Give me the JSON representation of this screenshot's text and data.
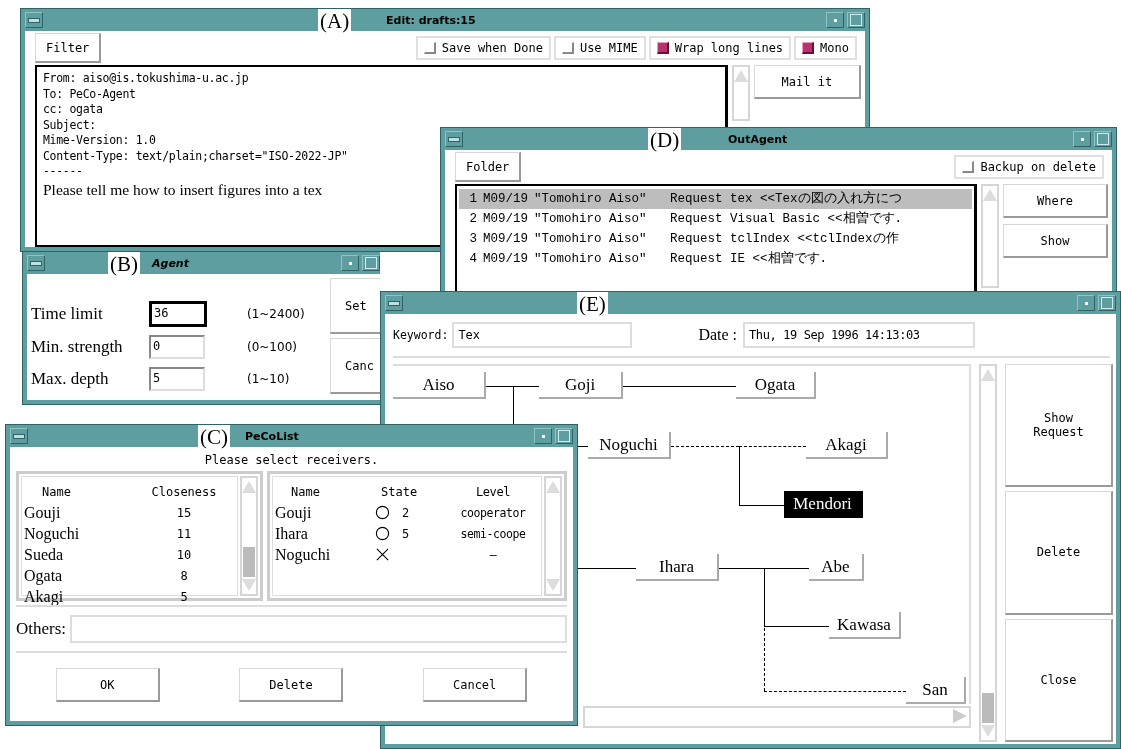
{
  "edit_window": {
    "annotation": "(A)",
    "title": "Edit: drafts:15",
    "filter_button": "Filter",
    "options": [
      {
        "label": "Save when Done",
        "checked": false
      },
      {
        "label": "Use MIME",
        "checked": false
      },
      {
        "label": "Wrap long lines",
        "checked": true
      },
      {
        "label": "Mono",
        "checked": true
      }
    ],
    "header_lines": [
      "From: aiso@is.tokushima-u.ac.jp",
      "To: PeCo-Agent",
      "cc: ogata",
      "Subject:",
      "Mime-Version: 1.0",
      "Content-Type: text/plain;charset=\"ISO-2022-JP\"",
      "------"
    ],
    "body_text": "Please tell me how to insert figures into a tex",
    "mail_button": "Mail it"
  },
  "outagent_window": {
    "annotation": "(D)",
    "title": "OutAgent",
    "folder_button": "Folder",
    "backup": {
      "label": "Backup on delete",
      "checked": false
    },
    "messages": [
      {
        "number": "1",
        "date": "M09/19",
        "sender": "\"Tomohiro Aiso\"",
        "subject": "Request tex <<Texの図の入れ方につ",
        "selected": true
      },
      {
        "number": "2",
        "date": "M09/19",
        "sender": "\"Tomohiro Aiso\"",
        "subject": "Request Visual Basic <<相曽です.",
        "selected": false
      },
      {
        "number": "3",
        "date": "M09/19",
        "sender": "\"Tomohiro Aiso\"",
        "subject": "Request tclIndex <<tclIndexの作",
        "selected": false
      },
      {
        "number": "4",
        "date": "M09/19",
        "sender": "\"Tomohiro Aiso\"",
        "subject": "Request IE <<相曽です.",
        "selected": false
      }
    ],
    "buttons": [
      "Where",
      "Show"
    ]
  },
  "agent_window": {
    "annotation": "(B)",
    "title": "Agent",
    "fields": [
      {
        "label": "Time limit",
        "value": "36",
        "range": "(1~2400)",
        "focused": true
      },
      {
        "label": "Min. strength",
        "value": "0",
        "range": "(0~100)",
        "focused": false
      },
      {
        "label": "Max. depth",
        "value": "5",
        "range": "(1~10)",
        "focused": false
      }
    ],
    "buttons": [
      "Set",
      "Canc"
    ]
  },
  "tree_window": {
    "annotation": "(E)",
    "keyword_label": "Keyword:",
    "keyword": "Tex",
    "date_label": "Date :",
    "date": "Thu, 19 Sep 1996 14:13:03",
    "tree": {
      "name": "Aiso",
      "selected": false,
      "children": [
        {
          "name": "Goji",
          "dashed": false,
          "selected": false,
          "children": [
            {
              "name": "Ogata",
              "dashed": false,
              "selected": false
            }
          ]
        },
        {
          "name": "Noguchi",
          "dashed": false,
          "selected": false,
          "children": [
            {
              "name": "Akagi",
              "dashed": true,
              "selected": false
            },
            {
              "name": "Mendori",
              "dashed": false,
              "selected": true
            }
          ]
        },
        {
          "name": "Ihara",
          "dashed": false,
          "selected": false,
          "children": [
            {
              "name": "Abe",
              "dashed": false,
              "selected": false
            },
            {
              "name": "Kawasa",
              "dashed": false,
              "selected": false
            },
            {
              "name": "San",
              "dashed": true,
              "selected": false
            }
          ]
        }
      ]
    },
    "buttons": [
      "Show Request",
      "Delete",
      "Close"
    ]
  },
  "receiver_window": {
    "annotation": "(C)",
    "title": "PeCoList",
    "prompt": "Please select receivers.",
    "candidates": {
      "columns": [
        "Name",
        "Closeness"
      ],
      "rows": [
        {
          "name": "Gouji",
          "closeness": "15"
        },
        {
          "name": "Noguchi",
          "closeness": "11"
        },
        {
          "name": "Sueda",
          "closeness": "10"
        },
        {
          "name": "Ogata",
          "closeness": "8"
        },
        {
          "name": "Akagi",
          "closeness": "5"
        }
      ]
    },
    "receivers": {
      "columns": [
        "Name",
        "State",
        "Level"
      ],
      "rows": [
        {
          "name": "Gouji",
          "kind": "circle",
          "count": "2",
          "level_text": "cooperator"
        },
        {
          "name": "Ihara",
          "kind": "circle",
          "count": "5",
          "level_text": "semi-coope"
        },
        {
          "name": "Noguchi",
          "kind": "cross",
          "level_text": "—"
        }
      ]
    },
    "others_label": "Others:",
    "buttons": [
      "OK",
      "Delete",
      "Cancel"
    ]
  }
}
